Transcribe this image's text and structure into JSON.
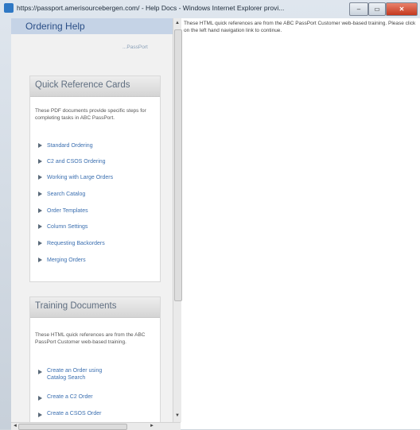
{
  "window": {
    "title": "https://passport.amerisourcebergen.com/ - Help Docs - Windows Internet Explorer provi...",
    "controls": {
      "minimize": "–",
      "maximize": "▭",
      "close": "✕"
    }
  },
  "left": {
    "header": "Ordering Help",
    "passport_link": "...PassPort"
  },
  "qrc": {
    "title": "Quick Reference Cards",
    "desc": "These PDF documents provide specific steps for completing tasks in ABC PassPort.",
    "items": [
      "Standard Ordering",
      "C2 and CSOS Ordering",
      "Working with Large Orders",
      "Search Catalog",
      "Order Templates",
      "Column Settings",
      "Requesting Backorders",
      "Merging Orders"
    ]
  },
  "training": {
    "title": "Training Documents",
    "desc": "These HTML quick references are from the ABC PassPort Customer web-based training.",
    "items": [
      {
        "line1": "Create an Order using",
        "line2": "Catalog Search"
      },
      {
        "line1": "Create a C2 Order",
        "line2": ""
      },
      {
        "line1": "Create a CSOS Order",
        "line2": ""
      }
    ]
  },
  "right": {
    "message": "These HTML quick references are from the ABC PassPort Customer web-based training. Please click on the left hand navigation link to continue."
  },
  "scroll": {
    "up": "▲",
    "down": "▼",
    "left": "◄",
    "right": "►"
  }
}
